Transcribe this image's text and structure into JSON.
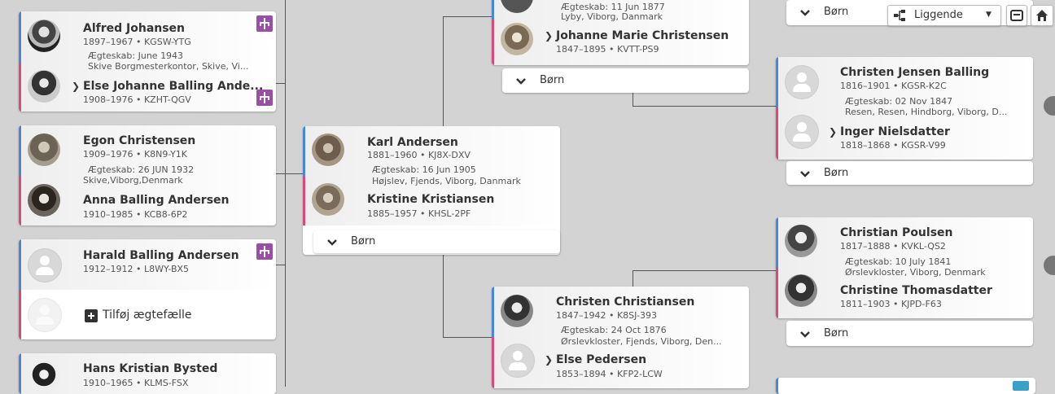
{
  "toolbar": {
    "view_label": "Liggende",
    "dropdown_arrow": "▼"
  },
  "born_label": "Børn",
  "add_spouse_label": "Tilføj ægtefælle",
  "col1": {
    "c1": {
      "husband": {
        "name": "Alfred Johansen",
        "life": "1897–1967 • KGSW-YTG"
      },
      "marriage_line1": "Ægteskab: June 1943",
      "marriage_line2": "Skive Borgmesterkontor, Skive, Vi...",
      "wife": {
        "name": "Else Johanne Balling Ande...",
        "life": "1908–1976 • KZHT-QGV"
      }
    },
    "c2": {
      "husband": {
        "name": "Egon Christensen",
        "life": "1909–1976 • K8N9-Y1K"
      },
      "marriage_line1": "Ægteskab: 26 JUN 1932",
      "marriage_line2": "Skive,Viborg,Denmark",
      "wife": {
        "name": "Anna Balling Andersen",
        "life": "1910–1985 • KCB8-6P2"
      }
    },
    "c3": {
      "husband": {
        "name": "Harald Balling Andersen",
        "life": "1912–1912 • L8WY-BX5"
      }
    },
    "c4": {
      "husband": {
        "name": "Hans Kristian Bysted",
        "life": "1910–1965 • KLMS-FSX"
      }
    }
  },
  "col2": {
    "husband": {
      "name": "Karl Andersen",
      "life": "1881–1960 • KJ8X-DXV"
    },
    "marriage_line1": "Ægteskab: 16 Jun 1905",
    "marriage_line2": "Højslev, Fjends, Viborg, Danmark",
    "wife": {
      "name": "Kristine Kristiansen",
      "life": "1885–1957 • KHSL-2PF"
    }
  },
  "col3": {
    "top": {
      "marriage_line1": "Ægteskab: 11 Jun 1877",
      "marriage_line2": "Lyby, Viborg, Danmark",
      "wife": {
        "name": "Johanne Marie Christensen",
        "life": "1847–1895 • KVTT-PS9"
      }
    },
    "bottom": {
      "husband": {
        "name": "Christen Christiansen",
        "life": "1847–1942 • K8SJ-393"
      },
      "marriage_line1": "Ægteskab: 24 Oct 1876",
      "marriage_line2": "Ørslevkloster, Fjends, Viborg, Den...",
      "wife": {
        "name": "Else Pedersen",
        "life": "1853–1894 • KFP2-LCW"
      }
    }
  },
  "col4": {
    "c2": {
      "husband": {
        "name": "Christen Jensen Balling",
        "life": "1816–1901 • KGSR-K2C"
      },
      "marriage_line1": "Ægteskab: 02 Nov 1847",
      "marriage_line2": "Resen, Resen, Hindborg, Viborg, D...",
      "wife": {
        "name": "Inger Nielsdatter",
        "life": "1818–1868 • KGSR-V99"
      }
    },
    "c3": {
      "husband": {
        "name": "Christian Poulsen",
        "life": "1817–1888 • KVKL-QS2"
      },
      "marriage_line1": "Ægteskab: 10 July 1841",
      "marriage_line2": "Ørslevkloster, Viborg, Denmark",
      "wife": {
        "name": "Christine Thomasdatter",
        "life": "1811–1903 • KJPD-F63"
      }
    }
  },
  "colors": {
    "male": "#4a86d8",
    "female": "#d94a7b",
    "tree_icon": "#9a4fa6"
  }
}
